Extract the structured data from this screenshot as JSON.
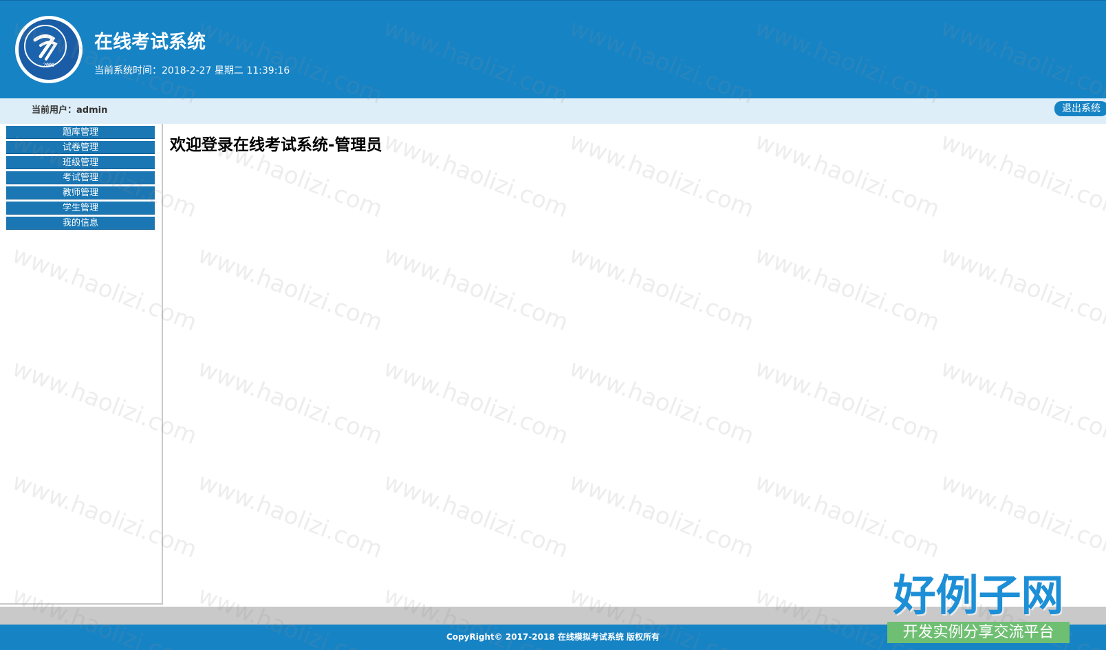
{
  "header": {
    "logo_year": "2000",
    "title": "在线考试系统",
    "system_time": "当前系统时间：2018-2-27 星期二 11:39:16"
  },
  "userbar": {
    "current_user": "当前用户：admin",
    "logout_label": "退出系统"
  },
  "sidebar": {
    "items": [
      {
        "label": "题库管理"
      },
      {
        "label": "试卷管理"
      },
      {
        "label": "班级管理"
      },
      {
        "label": "考试管理"
      },
      {
        "label": "教师管理"
      },
      {
        "label": "学生管理"
      },
      {
        "label": "我的信息"
      }
    ]
  },
  "main": {
    "heading": "欢迎登录在线考试系统-管理员"
  },
  "footer": {
    "copyright": "CopyRight© 2017-2018 在线模拟考试系统 版权所有"
  },
  "watermark": {
    "text": "www.haolizi.com",
    "brand_main": "好例子网",
    "brand_sub": "开发实例分享交流平台"
  },
  "colors": {
    "header_bg": "#1683c5",
    "userbar_bg": "#deeef8",
    "menu_item_bg": "#1a77b4",
    "footer_bg": "#1683c5"
  }
}
